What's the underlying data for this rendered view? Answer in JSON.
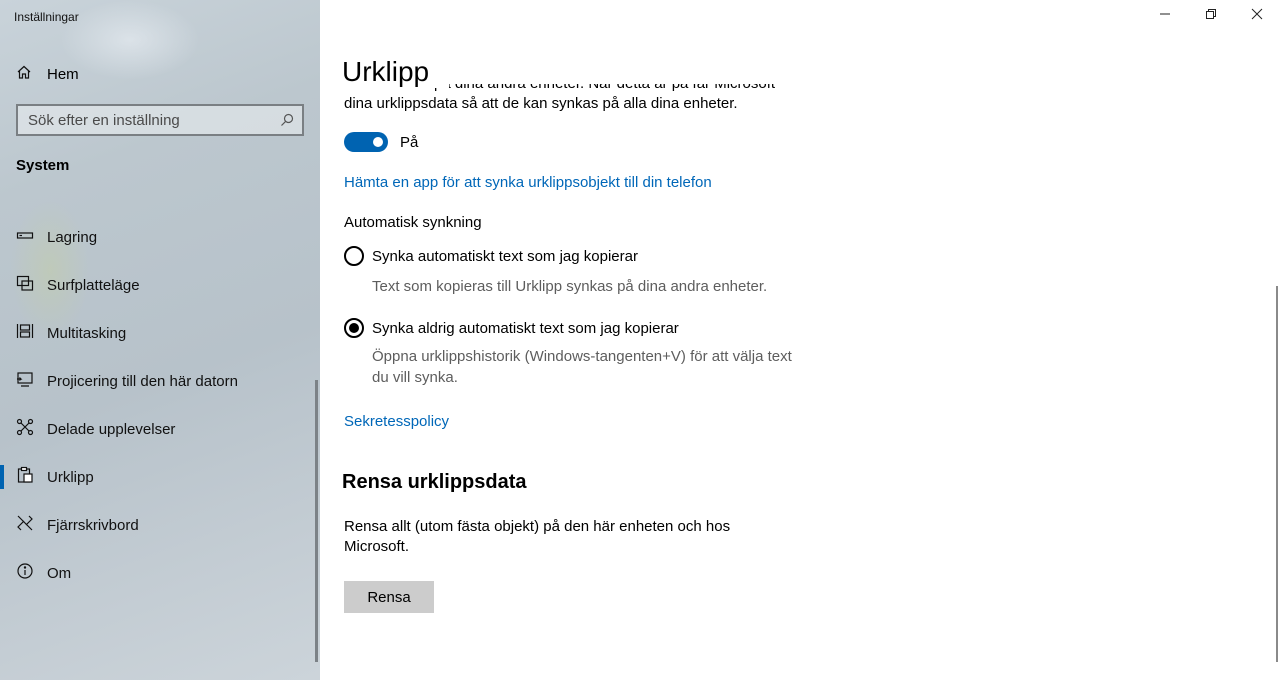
{
  "window": {
    "title": "Inställningar"
  },
  "sidebar": {
    "home_label": "Hem",
    "search_placeholder": "Sök efter en inställning",
    "section_title": "System",
    "items": [
      {
        "label": "Lagring",
        "icon": "storage-icon",
        "active": false
      },
      {
        "label": "Surfplatteläge",
        "icon": "tablet-mode-icon",
        "active": false
      },
      {
        "label": "Multitasking",
        "icon": "multitasking-icon",
        "active": false
      },
      {
        "label": "Projicering till den här datorn",
        "icon": "projecting-icon",
        "active": false
      },
      {
        "label": "Delade upplevelser",
        "icon": "shared-experiences-icon",
        "active": false
      },
      {
        "label": "Urklipp",
        "icon": "clipboard-icon",
        "active": true
      },
      {
        "label": "Fjärrskrivbord",
        "icon": "remote-desktop-icon",
        "active": false
      },
      {
        "label": "Om",
        "icon": "info-icon",
        "active": false
      }
    ]
  },
  "main": {
    "title": "Urklipp",
    "partial_line_1": "Klistra in text på dina andra enheter. När detta är på får Microsoft",
    "partial_line_2": "dina urklippsdata så att de kan synkas på alla dina enheter.",
    "toggle_label": "På",
    "get_app_link": "Hämta en app för att synka urklippsobjekt till din telefon",
    "auto_sync_heading": "Automatisk synkning",
    "radio_options": [
      {
        "label": "Synka automatiskt text som jag kopierar",
        "description": "Text som kopieras till Urklipp synkas på dina andra enheter.",
        "checked": false
      },
      {
        "label": "Synka aldrig automatiskt text som jag kopierar",
        "description": "Öppna urklippshistorik (Windows-tangenten+V) för att välja text du vill synka.",
        "checked": true
      }
    ],
    "privacy_link": "Sekretesspolicy",
    "clear_heading": "Rensa urklippsdata",
    "clear_description": "Rensa allt (utom fästa objekt) på den här enheten och hos Microsoft.",
    "clear_button": "Rensa"
  },
  "colors": {
    "accent": "#0063b1",
    "link": "#0067b8",
    "secondary_text": "#5d5d5d",
    "button_bg": "#cccccc"
  }
}
